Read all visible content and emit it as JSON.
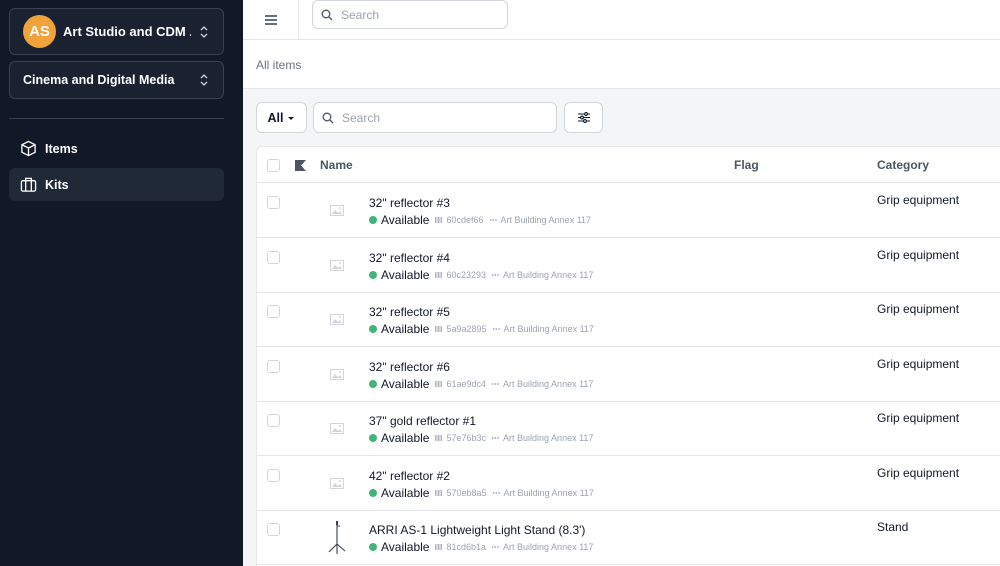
{
  "sidebar": {
    "org": {
      "initials": "AS",
      "name": "Art Studio and CDM ...",
      "avatar_color": "#f0a23b"
    },
    "department": "Cinema and Digital Media",
    "nav": [
      {
        "label": "Items",
        "icon": "cube-icon"
      },
      {
        "label": "Kits",
        "icon": "briefcase-icon"
      }
    ]
  },
  "topbar": {
    "search_placeholder": "Search"
  },
  "breadcrumb": "All items",
  "controls": {
    "filter_label": "All",
    "search_placeholder": "Search"
  },
  "table": {
    "columns": {
      "name": "Name",
      "flag": "Flag",
      "category": "Category"
    },
    "rows": [
      {
        "name": "32\" reflector #3",
        "status": "Available",
        "id": "60cdef66",
        "location": "Art Building Annex 117",
        "category": "Grip equipment",
        "thumb": "image-placeholder-icon"
      },
      {
        "name": "32\" reflector #4",
        "status": "Available",
        "id": "60c23293",
        "location": "Art Building Annex 117",
        "category": "Grip equipment",
        "thumb": "image-placeholder-icon"
      },
      {
        "name": "32\" reflector #5",
        "status": "Available",
        "id": "5a9a2895",
        "location": "Art Building Annex 117",
        "category": "Grip equipment",
        "thumb": "image-placeholder-icon"
      },
      {
        "name": "32\" reflector #6",
        "status": "Available",
        "id": "61ae9dc4",
        "location": "Art Building Annex 117",
        "category": "Grip equipment",
        "thumb": "image-placeholder-icon"
      },
      {
        "name": "37\" gold reflector #1",
        "status": "Available",
        "id": "57e76b3c",
        "location": "Art Building Annex 117",
        "category": "Grip equipment",
        "thumb": "image-placeholder-icon"
      },
      {
        "name": "42\" reflector #2",
        "status": "Available",
        "id": "570eb8a5",
        "location": "Art Building Annex 117",
        "category": "Grip equipment",
        "thumb": "image-placeholder-icon"
      },
      {
        "name": "ARRI AS-1 Lightweight Light Stand (8.3')",
        "status": "Available",
        "id": "81cd6b1a",
        "location": "Art Building Annex 117",
        "category": "Stand",
        "thumb": "light-stand-icon"
      }
    ]
  },
  "colors": {
    "sidebar_bg": "#111827",
    "available": "#3fb57a"
  }
}
